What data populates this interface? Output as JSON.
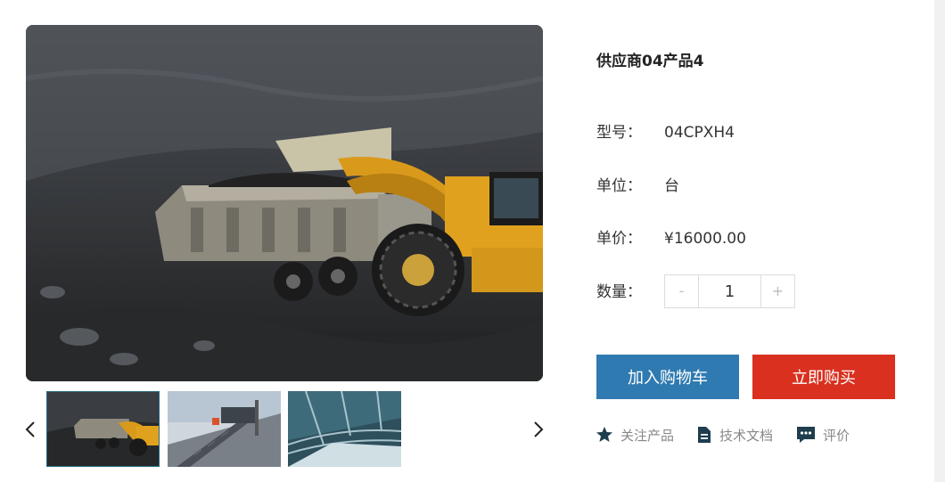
{
  "product": {
    "title": "供应商04产品4",
    "specs": [
      {
        "label": "型号：",
        "value": "04CPXH4"
      },
      {
        "label": "单位：",
        "value": "台"
      },
      {
        "label": "单价：",
        "value": "¥16000.00"
      }
    ],
    "quantity": {
      "label": "数量：",
      "value": "1",
      "minus": "-",
      "plus": "+"
    }
  },
  "buttons": {
    "add_to_cart": "加入购物车",
    "buy_now": "立即购买"
  },
  "actions": [
    {
      "label": "关注产品",
      "icon": "star-icon"
    },
    {
      "label": "技术文档",
      "icon": "document-icon"
    },
    {
      "label": "评价",
      "icon": "comment-icon"
    }
  ],
  "colors": {
    "cart": "#2f7ab0",
    "buy": "#d9301f",
    "icon": "#1e3d4d"
  }
}
